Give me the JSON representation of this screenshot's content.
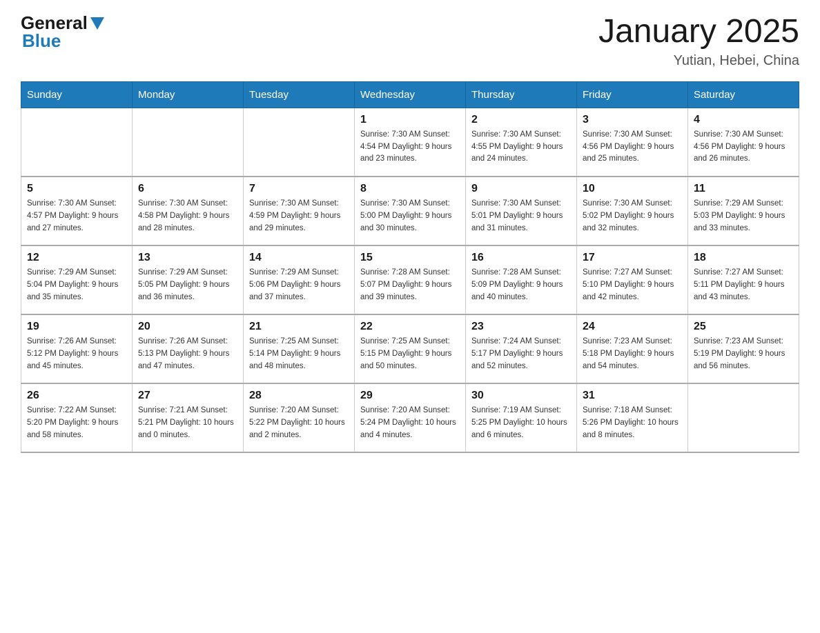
{
  "header": {
    "logo_general": "General",
    "logo_blue": "Blue",
    "title": "January 2025",
    "location": "Yutian, Hebei, China"
  },
  "days_of_week": [
    "Sunday",
    "Monday",
    "Tuesday",
    "Wednesday",
    "Thursday",
    "Friday",
    "Saturday"
  ],
  "weeks": [
    [
      {
        "day": "",
        "info": ""
      },
      {
        "day": "",
        "info": ""
      },
      {
        "day": "",
        "info": ""
      },
      {
        "day": "1",
        "info": "Sunrise: 7:30 AM\nSunset: 4:54 PM\nDaylight: 9 hours\nand 23 minutes."
      },
      {
        "day": "2",
        "info": "Sunrise: 7:30 AM\nSunset: 4:55 PM\nDaylight: 9 hours\nand 24 minutes."
      },
      {
        "day": "3",
        "info": "Sunrise: 7:30 AM\nSunset: 4:56 PM\nDaylight: 9 hours\nand 25 minutes."
      },
      {
        "day": "4",
        "info": "Sunrise: 7:30 AM\nSunset: 4:56 PM\nDaylight: 9 hours\nand 26 minutes."
      }
    ],
    [
      {
        "day": "5",
        "info": "Sunrise: 7:30 AM\nSunset: 4:57 PM\nDaylight: 9 hours\nand 27 minutes."
      },
      {
        "day": "6",
        "info": "Sunrise: 7:30 AM\nSunset: 4:58 PM\nDaylight: 9 hours\nand 28 minutes."
      },
      {
        "day": "7",
        "info": "Sunrise: 7:30 AM\nSunset: 4:59 PM\nDaylight: 9 hours\nand 29 minutes."
      },
      {
        "day": "8",
        "info": "Sunrise: 7:30 AM\nSunset: 5:00 PM\nDaylight: 9 hours\nand 30 minutes."
      },
      {
        "day": "9",
        "info": "Sunrise: 7:30 AM\nSunset: 5:01 PM\nDaylight: 9 hours\nand 31 minutes."
      },
      {
        "day": "10",
        "info": "Sunrise: 7:30 AM\nSunset: 5:02 PM\nDaylight: 9 hours\nand 32 minutes."
      },
      {
        "day": "11",
        "info": "Sunrise: 7:29 AM\nSunset: 5:03 PM\nDaylight: 9 hours\nand 33 minutes."
      }
    ],
    [
      {
        "day": "12",
        "info": "Sunrise: 7:29 AM\nSunset: 5:04 PM\nDaylight: 9 hours\nand 35 minutes."
      },
      {
        "day": "13",
        "info": "Sunrise: 7:29 AM\nSunset: 5:05 PM\nDaylight: 9 hours\nand 36 minutes."
      },
      {
        "day": "14",
        "info": "Sunrise: 7:29 AM\nSunset: 5:06 PM\nDaylight: 9 hours\nand 37 minutes."
      },
      {
        "day": "15",
        "info": "Sunrise: 7:28 AM\nSunset: 5:07 PM\nDaylight: 9 hours\nand 39 minutes."
      },
      {
        "day": "16",
        "info": "Sunrise: 7:28 AM\nSunset: 5:09 PM\nDaylight: 9 hours\nand 40 minutes."
      },
      {
        "day": "17",
        "info": "Sunrise: 7:27 AM\nSunset: 5:10 PM\nDaylight: 9 hours\nand 42 minutes."
      },
      {
        "day": "18",
        "info": "Sunrise: 7:27 AM\nSunset: 5:11 PM\nDaylight: 9 hours\nand 43 minutes."
      }
    ],
    [
      {
        "day": "19",
        "info": "Sunrise: 7:26 AM\nSunset: 5:12 PM\nDaylight: 9 hours\nand 45 minutes."
      },
      {
        "day": "20",
        "info": "Sunrise: 7:26 AM\nSunset: 5:13 PM\nDaylight: 9 hours\nand 47 minutes."
      },
      {
        "day": "21",
        "info": "Sunrise: 7:25 AM\nSunset: 5:14 PM\nDaylight: 9 hours\nand 48 minutes."
      },
      {
        "day": "22",
        "info": "Sunrise: 7:25 AM\nSunset: 5:15 PM\nDaylight: 9 hours\nand 50 minutes."
      },
      {
        "day": "23",
        "info": "Sunrise: 7:24 AM\nSunset: 5:17 PM\nDaylight: 9 hours\nand 52 minutes."
      },
      {
        "day": "24",
        "info": "Sunrise: 7:23 AM\nSunset: 5:18 PM\nDaylight: 9 hours\nand 54 minutes."
      },
      {
        "day": "25",
        "info": "Sunrise: 7:23 AM\nSunset: 5:19 PM\nDaylight: 9 hours\nand 56 minutes."
      }
    ],
    [
      {
        "day": "26",
        "info": "Sunrise: 7:22 AM\nSunset: 5:20 PM\nDaylight: 9 hours\nand 58 minutes."
      },
      {
        "day": "27",
        "info": "Sunrise: 7:21 AM\nSunset: 5:21 PM\nDaylight: 10 hours\nand 0 minutes."
      },
      {
        "day": "28",
        "info": "Sunrise: 7:20 AM\nSunset: 5:22 PM\nDaylight: 10 hours\nand 2 minutes."
      },
      {
        "day": "29",
        "info": "Sunrise: 7:20 AM\nSunset: 5:24 PM\nDaylight: 10 hours\nand 4 minutes."
      },
      {
        "day": "30",
        "info": "Sunrise: 7:19 AM\nSunset: 5:25 PM\nDaylight: 10 hours\nand 6 minutes."
      },
      {
        "day": "31",
        "info": "Sunrise: 7:18 AM\nSunset: 5:26 PM\nDaylight: 10 hours\nand 8 minutes."
      },
      {
        "day": "",
        "info": ""
      }
    ]
  ]
}
